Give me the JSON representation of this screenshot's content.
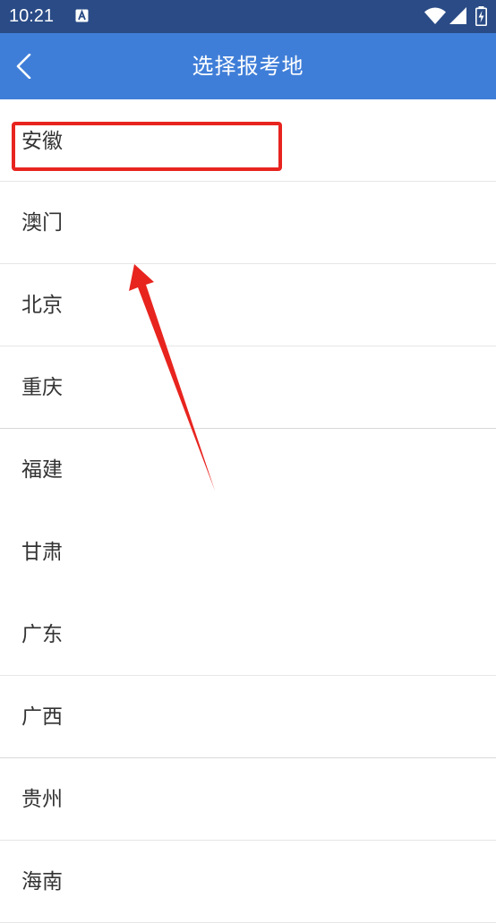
{
  "status_bar": {
    "time": "10:21",
    "notification_icon": "font-a-icon",
    "wifi_icon": "wifi-icon",
    "signal_icon": "signal-icon",
    "battery_icon": "battery-charging-icon"
  },
  "app_bar": {
    "title": "选择报考地",
    "back_icon": "chevron-left-icon",
    "color": "#3f7ed8"
  },
  "provinces": [
    {
      "label": "安徽"
    },
    {
      "label": "澳门"
    },
    {
      "label": "北京"
    },
    {
      "label": "重庆"
    },
    {
      "label": "福建"
    },
    {
      "label": "甘肃"
    },
    {
      "label": "广东"
    },
    {
      "label": "广西"
    },
    {
      "label": "贵州"
    },
    {
      "label": "海南"
    }
  ],
  "annotation": {
    "color": "#e8241f",
    "highlighted_item": "安徽"
  }
}
